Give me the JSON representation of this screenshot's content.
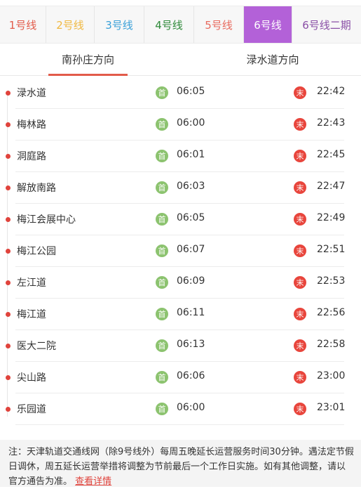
{
  "line_tabs": [
    {
      "label": "1号线",
      "color": "#e25b4a",
      "active": false
    },
    {
      "label": "2号线",
      "color": "#f0b840",
      "active": false
    },
    {
      "label": "3号线",
      "color": "#3aa0d8",
      "active": false
    },
    {
      "label": "4号线",
      "color": "#2f8a3a",
      "active": false
    },
    {
      "label": "5号线",
      "color": "#e86a5e",
      "active": false
    },
    {
      "label": "6号线",
      "color": "#ffffff",
      "active": true,
      "background": "#b361d8"
    },
    {
      "label": "6号线二期",
      "color": "#8a4fa6",
      "active": false
    }
  ],
  "direction_tabs": [
    {
      "label": "南孙庄方向",
      "active": true
    },
    {
      "label": "渌水道方向",
      "active": false
    }
  ],
  "badges": {
    "first": "首",
    "last": "末"
  },
  "stations": [
    {
      "name": "渌水道",
      "first": "06:05",
      "last": "22:42"
    },
    {
      "name": "梅林路",
      "first": "06:00",
      "last": "22:43"
    },
    {
      "name": "洞庭路",
      "first": "06:01",
      "last": "22:45"
    },
    {
      "name": "解放南路",
      "first": "06:03",
      "last": "22:47"
    },
    {
      "name": "梅江会展中心",
      "first": "06:05",
      "last": "22:49"
    },
    {
      "name": "梅江公园",
      "first": "06:07",
      "last": "22:51"
    },
    {
      "name": "左江道",
      "first": "06:09",
      "last": "22:53"
    },
    {
      "name": "梅江道",
      "first": "06:11",
      "last": "22:56"
    },
    {
      "name": "医大二院",
      "first": "06:13",
      "last": "22:58"
    },
    {
      "name": "尖山路",
      "first": "06:06",
      "last": "23:00"
    },
    {
      "name": "乐园道",
      "first": "06:00",
      "last": "23:01"
    }
  ],
  "note": {
    "text": "注：天津轨道交通线网（除9号线外）每周五晚延长运营服务时间30分钟。遇法定节假日调休，周五延长运营举措将调整为节前最后一个工作日实施。如有其他调整，请以官方通告为准。",
    "link": "查看详情"
  }
}
